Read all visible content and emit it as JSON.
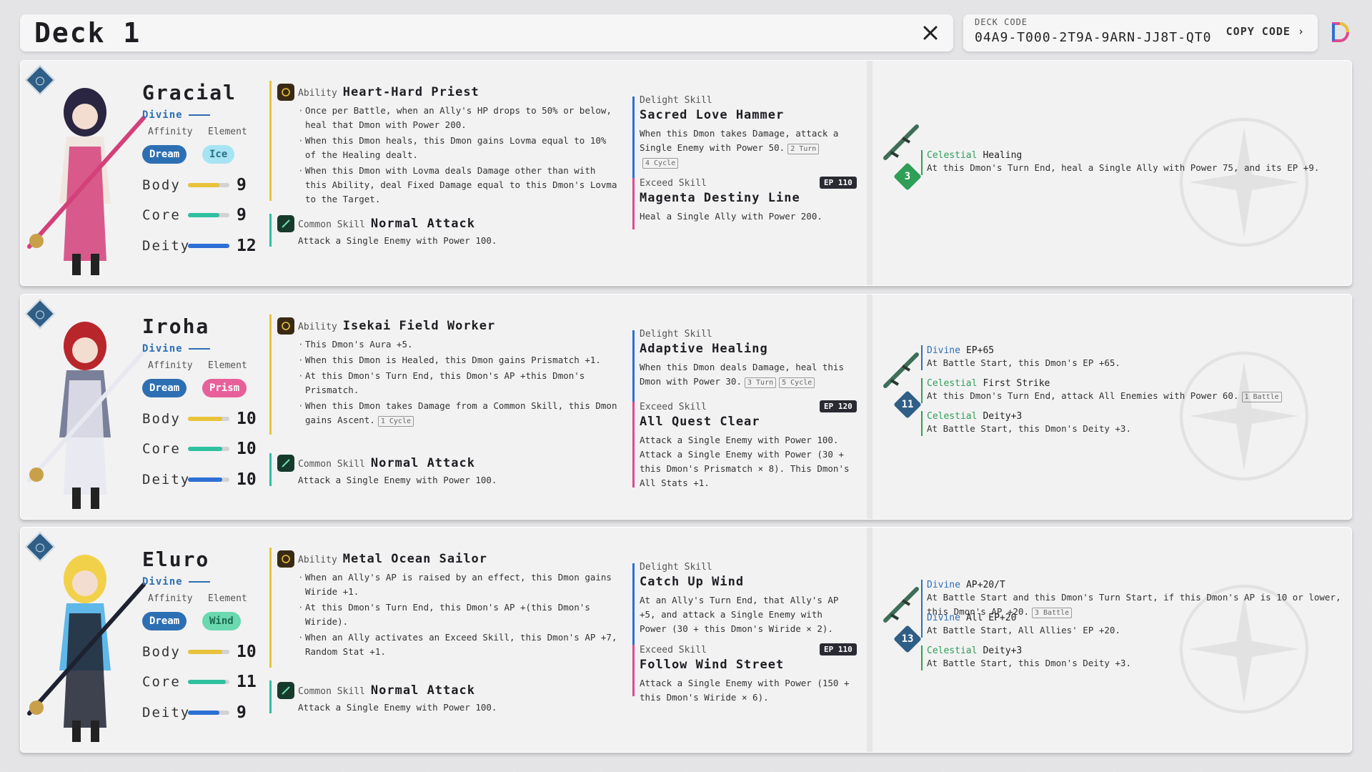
{
  "header": {
    "deck_title": "Deck 1",
    "deck_code_label": "DECK CODE",
    "deck_code": "04A9-T000-2T9A-9ARN-JJ8T-QT0",
    "copy_label": "COPY CODE ›"
  },
  "labels": {
    "affinity": "Affinity",
    "element": "Element",
    "body": "Body",
    "core": "Core",
    "deity": "Deity",
    "ability": "Ability",
    "common": "Common Skill",
    "delight": "Delight Skill",
    "exceed": "Exceed Skill"
  },
  "colors": {
    "divine": "#2d6fb3",
    "celestial": "#2f9e57",
    "body_bar": "#e8c33a",
    "core_bar": "#2fc0a0",
    "deity_bar": "#2d6fd4",
    "accent_orange": "#e2773a",
    "exceed_pink": "#e04a90"
  },
  "cards": [
    {
      "name": "Gracial",
      "class": "Divine",
      "affinity": "Dream",
      "element": "Ice",
      "element_color": "#a6e4f3",
      "element_text_color": "#2b6f86",
      "stats": {
        "body": 9,
        "core": 9,
        "deity": 12
      },
      "ability_name": "Heart-Hard Priest",
      "ability_lines": [
        "Once per Battle, when an Ally's HP drops to 50% or below, heal that Dmon with Power 200.",
        "When this Dmon heals, this Dmon gains Lovma equal to 10% of the Healing dealt.",
        "When this Dmon with Lovma deals Damage other than with this Ability, deal Fixed Damage equal to this Dmon's Lovma to the Target."
      ],
      "common_name": "Normal Attack",
      "common_desc": "Attack a Single Enemy with Power 100.",
      "delight_name": "Sacred Love Hammer",
      "delight_desc": "When this Dmon takes Damage, attack a Single Enemy with Power 50.",
      "delight_tags": [
        "2 Turn",
        "4 Cycle"
      ],
      "exceed_ep": "EP 110",
      "exceed_name": "Magenta Destiny Line",
      "exceed_desc": "Heal a Single Ally with Power 200.",
      "equip_level": "3",
      "equip_gem_color": "#2f9e57",
      "equipment": [
        {
          "type": "Celestial",
          "name": "Healing",
          "desc": "At this Dmon's Turn End, heal a Single Ally with Power 75, and its EP +9."
        }
      ]
    },
    {
      "name": "Iroha",
      "class": "Divine",
      "affinity": "Dream",
      "element": "Prism",
      "element_color": "#e8609a",
      "element_text_color": "#ffffff",
      "stats": {
        "body": 10,
        "core": 10,
        "deity": 10
      },
      "ability_name": "Isekai Field Worker",
      "ability_lines": [
        "This Dmon's Aura +5.",
        "When this Dmon is Healed, this Dmon gains Prismatch +1.",
        "At this Dmon's Turn End, this Dmon's AP +this Dmon's Prismatch.",
        "When this Dmon takes Damage from a Common Skill, this Dmon gains Ascent."
      ],
      "ability_tag": "1 Cycle",
      "common_name": "Normal Attack",
      "common_desc": "Attack a Single Enemy with Power 100.",
      "delight_name": "Adaptive Healing",
      "delight_desc": "When this Dmon deals Damage, heal this Dmon with Power 30.",
      "delight_tags": [
        "3 Turn",
        "5 Cycle"
      ],
      "exceed_ep": "EP 120",
      "exceed_name": "All Quest Clear",
      "exceed_desc": "Attack a Single Enemy with Power 100. Attack a Single Enemy with Power (30 + this Dmon's Prismatch × 8). This Dmon's All Stats +1.",
      "equip_level": "11",
      "equip_gem_color": "#2f5e86",
      "equipment": [
        {
          "type": "Divine",
          "name": "EP+65",
          "desc": "At Battle Start, this Dmon's EP +65."
        },
        {
          "type": "Celestial",
          "name": "First Strike",
          "desc": "At this Dmon's Turn End, attack All Enemies with Power 60.",
          "tag": "1 Battle"
        },
        {
          "type": "Celestial",
          "name": "Deity+3",
          "desc": "At Battle Start, this Dmon's Deity +3."
        }
      ]
    },
    {
      "name": "Eluro",
      "class": "Divine",
      "affinity": "Dream",
      "element": "Wind",
      "element_color": "#6ad9b0",
      "element_text_color": "#1f6a4e",
      "stats": {
        "body": 10,
        "core": 11,
        "deity": 9
      },
      "ability_name": "Metal Ocean Sailor",
      "ability_lines": [
        "When an Ally's AP is raised by an effect, this Dmon gains Wiride +1.",
        "At this Dmon's Turn End, this Dmon's AP +(this Dmon's Wiride).",
        "When an Ally activates an Exceed Skill, this Dmon's AP +7, Random Stat +1."
      ],
      "common_name": "Normal Attack",
      "common_desc": "Attack a Single Enemy with Power 100.",
      "delight_name": "Catch Up Wind",
      "delight_desc": "At an Ally's Turn End, that Ally's AP +5, and attack a Single Enemy with Power (30 + this Dmon's Wiride × 2).",
      "delight_tags": [],
      "exceed_ep": "EP 110",
      "exceed_name": "Follow Wind Street",
      "exceed_desc": "Attack a Single Enemy with Power (150 + this Dmon's Wiride × 6).",
      "equip_level": "13",
      "equip_gem_color": "#2f5e86",
      "equipment": [
        {
          "type": "Divine",
          "name": "AP+20/T",
          "desc": "At Battle Start and this Dmon's Turn Start, if this Dmon's AP is 10 or lower, this Dmon's AP +20.",
          "tag": "3 Battle"
        },
        {
          "type": "Divine",
          "name": "All EP+20",
          "desc": "At Battle Start, All Allies' EP +20."
        },
        {
          "type": "Celestial",
          "name": "Deity+3",
          "desc": "At Battle Start, this Dmon's Deity +3."
        }
      ]
    }
  ]
}
